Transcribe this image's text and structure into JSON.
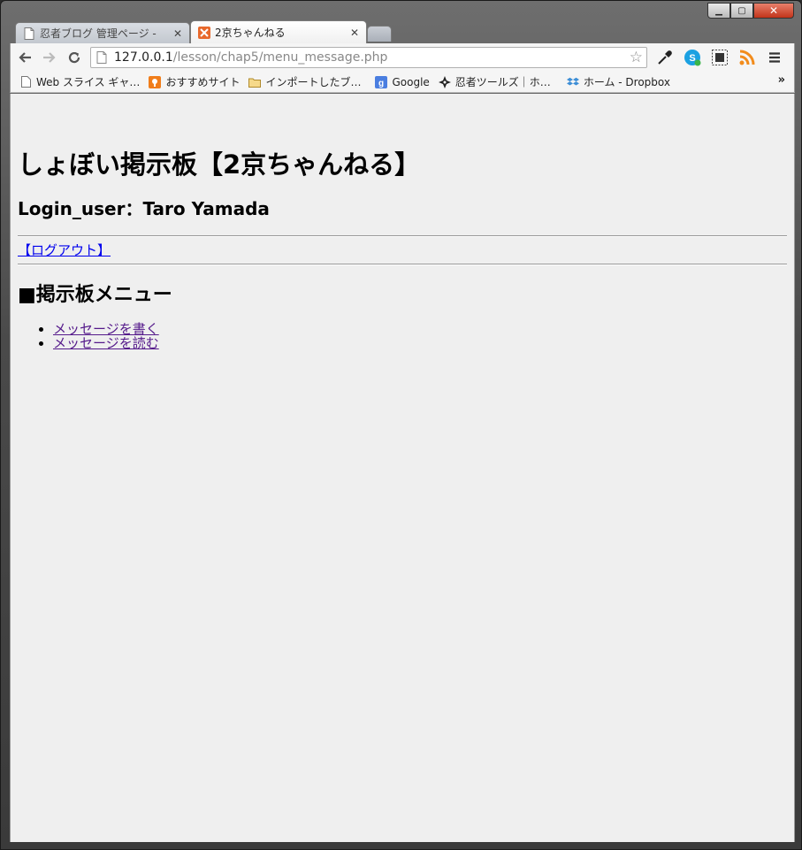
{
  "window": {
    "controls": {
      "minimize": "▁",
      "maximize": "▢",
      "close": "✕"
    }
  },
  "tabs": [
    {
      "title": "忍者ブログ 管理ページ -",
      "icon": "page-icon",
      "active": false
    },
    {
      "title": "2京ちゃんねる",
      "icon": "xampp-icon",
      "active": true
    }
  ],
  "toolbar": {
    "url_host": "127.0.0.1",
    "url_path": "/lesson/chap5/menu_message.php"
  },
  "bookmarks": [
    {
      "label": "Web スライス ギャ…",
      "icon": "page-icon"
    },
    {
      "label": "おすすめサイト",
      "icon": "recommend-icon"
    },
    {
      "label": "インポートしたブ…",
      "icon": "folder-icon"
    },
    {
      "label": "Google",
      "icon": "google-icon"
    },
    {
      "label": "忍者ツールズ｜ホ…",
      "icon": "ninja-icon"
    },
    {
      "label": "ホーム - Dropbox",
      "icon": "dropbox-icon"
    }
  ],
  "bookmarks_more": "»",
  "page": {
    "title": "しょぼい掲示板【2京ちゃんねる】",
    "login_user": "Login_user：Taro Yamada",
    "logout_link": "【ログアウト】",
    "menu_heading": "■掲示板メニュー",
    "menu_items": [
      {
        "label": "メッセージを書く"
      },
      {
        "label": "メッセージを読む"
      }
    ]
  }
}
